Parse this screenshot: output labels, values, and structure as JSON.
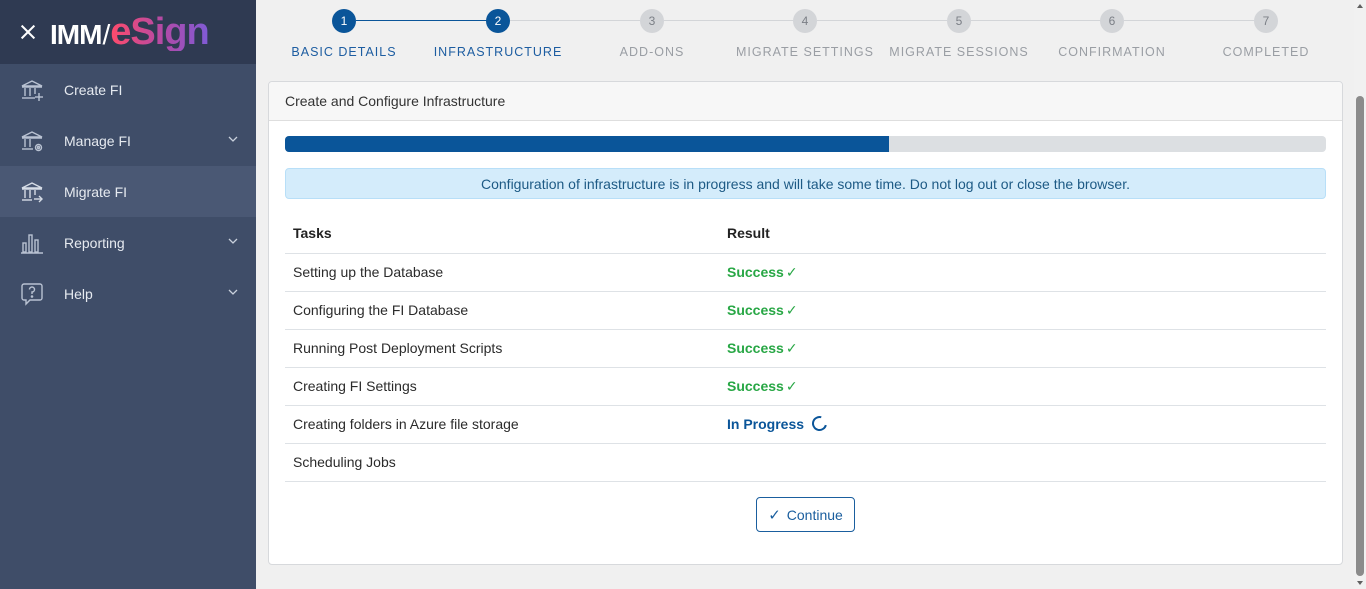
{
  "app": {
    "logo_left": "IMM",
    "logo_slash": "/",
    "logo_right": "eSign"
  },
  "sidebar": {
    "items": [
      {
        "label": "Create FI",
        "icon": "bank-plus-icon",
        "has_chevron": false,
        "active": false
      },
      {
        "label": "Manage FI",
        "icon": "bank-gear-icon",
        "has_chevron": true,
        "active": false
      },
      {
        "label": "Migrate FI",
        "icon": "bank-arrow-icon",
        "has_chevron": false,
        "active": true
      },
      {
        "label": "Reporting",
        "icon": "bar-chart-icon",
        "has_chevron": true,
        "active": false
      },
      {
        "label": "Help",
        "icon": "help-bubble-icon",
        "has_chevron": true,
        "active": false
      }
    ]
  },
  "stepper": {
    "steps": [
      {
        "num": "1",
        "label": "BASIC DETAILS",
        "state": "done"
      },
      {
        "num": "2",
        "label": "INFRASTRUCTURE",
        "state": "done"
      },
      {
        "num": "3",
        "label": "ADD-ONS",
        "state": "pending"
      },
      {
        "num": "4",
        "label": "MIGRATE SETTINGS",
        "state": "pending"
      },
      {
        "num": "5",
        "label": "MIGRATE SESSIONS",
        "state": "pending"
      },
      {
        "num": "6",
        "label": "CONFIRMATION",
        "state": "pending"
      },
      {
        "num": "7",
        "label": "COMPLETED",
        "state": "pending"
      }
    ]
  },
  "card": {
    "title": "Create and Configure Infrastructure",
    "progress_percent": 58,
    "alert": "Configuration of infrastructure is in progress and will take some time. Do not log out or close the browser.",
    "table": {
      "headers": [
        "Tasks",
        "Result"
      ],
      "rows": [
        {
          "task": "Setting up the Database",
          "result": "Success",
          "status": "success"
        },
        {
          "task": "Configuring the FI Database",
          "result": "Success",
          "status": "success"
        },
        {
          "task": "Running Post Deployment Scripts",
          "result": "Success",
          "status": "success"
        },
        {
          "task": "Creating FI Settings",
          "result": "Success",
          "status": "success"
        },
        {
          "task": "Creating folders in Azure file storage",
          "result": "In Progress",
          "status": "progress"
        },
        {
          "task": "Scheduling Jobs",
          "result": "",
          "status": "none"
        }
      ]
    },
    "continue_label": "Continue"
  },
  "colors": {
    "primary": "#0a5599",
    "success": "#28a745",
    "sidebar": "#3f4d68",
    "sidebar_dark": "#2f3a52"
  }
}
